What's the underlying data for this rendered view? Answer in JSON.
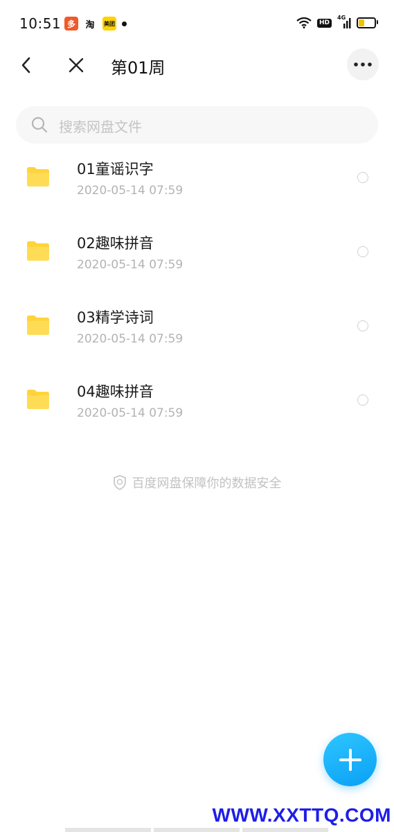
{
  "status_bar": {
    "time": "10:51",
    "notifications": [
      {
        "icon": "pinduoduo-app-icon",
        "glyph": "多"
      },
      {
        "icon": "taobao-app-icon",
        "glyph": "淘"
      },
      {
        "icon": "meituan-app-icon",
        "glyph": "美团"
      }
    ],
    "hd_label": "HD",
    "network_label": "4G",
    "battery_level": 0.35,
    "battery_color": "#f2c200"
  },
  "nav": {
    "title": "第01周"
  },
  "search": {
    "placeholder": "搜索网盘文件"
  },
  "files": [
    {
      "name": "01童谣识字",
      "date": "2020-05-14  07:59"
    },
    {
      "name": "02趣味拼音",
      "date": "2020-05-14  07:59"
    },
    {
      "name": "03精学诗词",
      "date": "2020-05-14  07:59"
    },
    {
      "name": "04趣味拼音",
      "date": "2020-05-14  07:59"
    }
  ],
  "security_note": "百度网盘保障你的数据安全",
  "watermark": "WWW.XXTTQ.COM",
  "colors": {
    "folder": "#ffd43b",
    "fab": "#15aaf7",
    "watermark": "#1e1ee8"
  }
}
